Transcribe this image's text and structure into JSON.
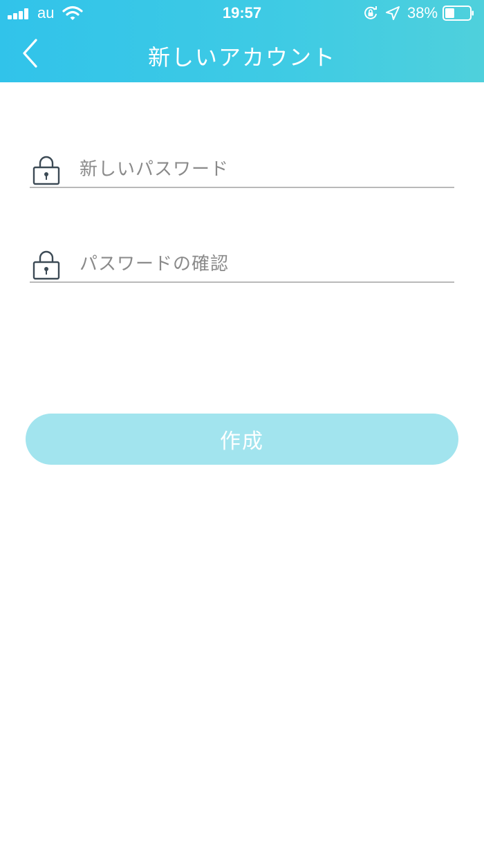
{
  "status_bar": {
    "carrier": "au",
    "time": "19:57",
    "battery_percent": "38%",
    "battery_level": 0.38,
    "icons": [
      "signal-icon",
      "wifi-icon",
      "rotation-lock-icon",
      "location-arrow-icon",
      "battery-icon"
    ]
  },
  "nav": {
    "title": "新しいアカウント",
    "back_icon": "chevron-left-icon"
  },
  "form": {
    "new_password": {
      "placeholder": "新しいパスワード",
      "value": "",
      "icon": "lock-icon"
    },
    "confirm_password": {
      "placeholder": "パスワードの確認",
      "value": "",
      "icon": "lock-icon"
    }
  },
  "actions": {
    "create_label": "作成"
  },
  "colors": {
    "header_gradient_start": "#31c3ea",
    "header_gradient_end": "#4fd0dc",
    "button_disabled": "#a2e4ee",
    "underline": "#b9b9b9",
    "placeholder": "#8a8a8a"
  }
}
